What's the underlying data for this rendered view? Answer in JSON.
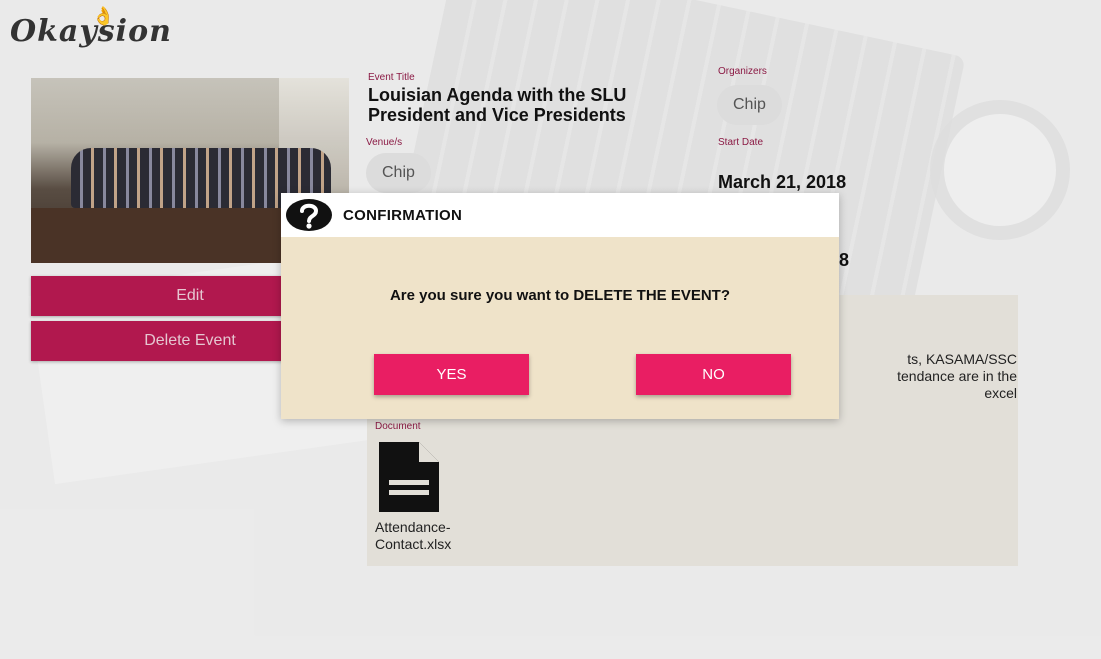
{
  "app": {
    "logo_text": "Okaysion",
    "logo_icon": "ok-hand-icon"
  },
  "actions": {
    "edit_label": "Edit",
    "delete_label": "Delete Event"
  },
  "event": {
    "title_label": "Event Title",
    "title": "Louisian Agenda with the SLU President and Vice Presidents",
    "organizers_label": "Organizers",
    "organizer_chip": "Chip",
    "venues_label": "Venue/s",
    "venue_chip": "Chip",
    "start_date_label": "Start Date",
    "start_date": "March 21, 2018",
    "end_date_partial": "8",
    "description_partial": "ts, KASAMA/SSC\ntendance are in the excel",
    "document_label": "Document",
    "document_name": "Attendance-\nContact.xlsx",
    "document_icon": "document-icon"
  },
  "dialog": {
    "icon": "question-mark-icon",
    "title": "CONFIRMATION",
    "message": "Are you sure you want to DELETE THE EVENT?",
    "yes_label": "YES",
    "no_label": "NO"
  },
  "colors": {
    "primary_button": "#b4184f",
    "dialog_button": "#e91e63",
    "label_accent": "#8d1a45",
    "dialog_body": "#efe3c9"
  }
}
